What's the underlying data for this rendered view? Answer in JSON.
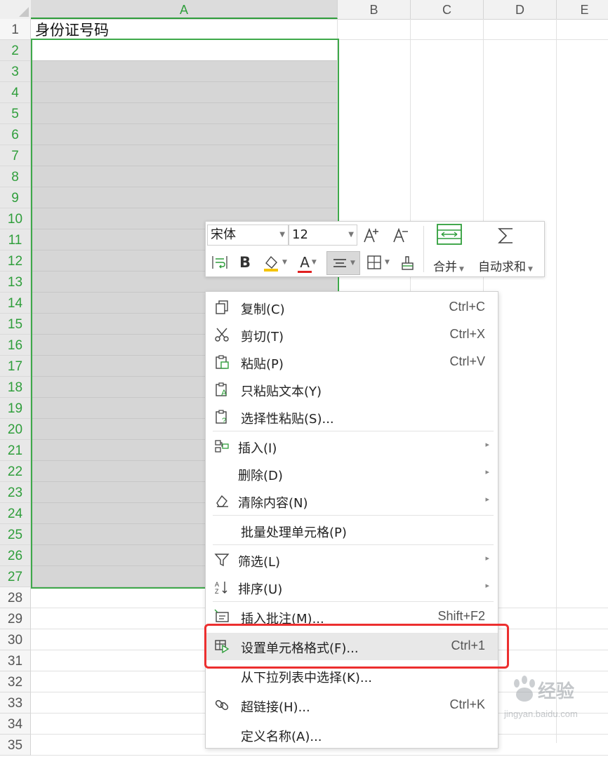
{
  "columns": [
    "A",
    "B",
    "C",
    "D",
    "E"
  ],
  "rows": [
    "1",
    "2",
    "3",
    "4",
    "5",
    "6",
    "7",
    "8",
    "9",
    "10",
    "11",
    "12",
    "13",
    "14",
    "15",
    "16",
    "17",
    "18",
    "19",
    "20",
    "21",
    "22",
    "23",
    "24",
    "25",
    "26",
    "27",
    "28",
    "29",
    "30",
    "31",
    "32",
    "33",
    "34",
    "35"
  ],
  "cells": {
    "A1": "身份证号码"
  },
  "toolbar": {
    "font_name": "宋体",
    "font_size": "12",
    "merge_label": "合并",
    "autosum_label": "自动求和",
    "bold_label": "B",
    "font_color_label": "A",
    "accent_colors": {
      "font_color": "#e02020",
      "fill_color": "#f5c400",
      "merge_icon": "#2f9e3b"
    }
  },
  "context_menu": {
    "items": [
      {
        "label": "复制(C)",
        "shortcut": "Ctrl+C",
        "icon": "copy-icon"
      },
      {
        "label": "剪切(T)",
        "shortcut": "Ctrl+X",
        "icon": "scissors-icon"
      },
      {
        "label": "粘贴(P)",
        "shortcut": "Ctrl+V",
        "icon": "paste-icon"
      },
      {
        "label": "只粘贴文本(Y)",
        "shortcut": "",
        "icon": "paste-text-icon"
      },
      {
        "label": "选择性粘贴(S)...",
        "shortcut": "",
        "icon": "paste-special-icon"
      },
      {
        "label": "插入(I)",
        "shortcut": "",
        "icon": "insert-icon",
        "submenu": true
      },
      {
        "label": "删除(D)",
        "shortcut": "",
        "icon": "",
        "submenu": true
      },
      {
        "label": "清除内容(N)",
        "shortcut": "",
        "icon": "eraser-icon",
        "submenu": true
      },
      {
        "label": "批量处理单元格(P)",
        "shortcut": "",
        "icon": ""
      },
      {
        "label": "筛选(L)",
        "shortcut": "",
        "icon": "filter-icon",
        "submenu": true
      },
      {
        "label": "排序(U)",
        "shortcut": "",
        "icon": "sort-icon",
        "submenu": true
      },
      {
        "label": "插入批注(M)...",
        "shortcut": "Shift+F2",
        "icon": "comment-icon"
      },
      {
        "label": "设置单元格格式(F)...",
        "shortcut": "Ctrl+1",
        "icon": "format-cells-icon",
        "highlighted": true
      },
      {
        "label": "从下拉列表中选择(K)...",
        "shortcut": "",
        "icon": ""
      },
      {
        "label": "超链接(H)...",
        "shortcut": "Ctrl+K",
        "icon": "link-icon"
      },
      {
        "label": "定义名称(A)...",
        "shortcut": "",
        "icon": ""
      }
    ]
  },
  "highlight_color": "#ec2f2f",
  "selection_color": "#3ea84a",
  "watermark": {
    "text": "Baidu经验",
    "url": "jingyan.baidu.com"
  }
}
